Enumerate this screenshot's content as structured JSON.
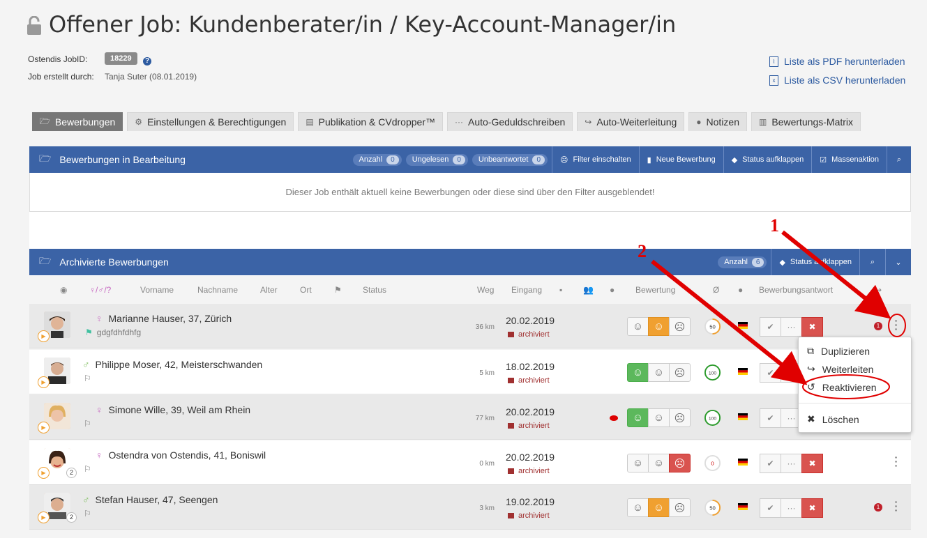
{
  "header": {
    "title": "Offener Job: Kundenberater/in / Key-Account-Manager/in",
    "jobid_label": "Ostendis JobID:",
    "jobid_value": "18229",
    "created_label": "Job erstellt durch:",
    "created_value": "Tanja Suter (08.01.2019)",
    "pdf_link": "Liste als PDF herunterladen",
    "csv_link": "Liste als CSV herunterladen"
  },
  "tabs": [
    {
      "label": "Bewerbungen",
      "icon": "folder-open-icon"
    },
    {
      "label": "Einstellungen & Berechtigungen",
      "icon": "gears-icon"
    },
    {
      "label": "Publikation & CVdropper™",
      "icon": "id-card-icon"
    },
    {
      "label": "Auto-Geduldschreiben",
      "icon": "ellipsis-icon"
    },
    {
      "label": "Auto-Weiterleitung",
      "icon": "share-icon"
    },
    {
      "label": "Notizen",
      "icon": "comment-icon"
    },
    {
      "label": "Bewertungs-Matrix",
      "icon": "bar-chart-icon"
    }
  ],
  "panel1": {
    "title": "Bewerbungen in Bearbeitung",
    "pills": [
      {
        "label": "Anzahl",
        "count": "0"
      },
      {
        "label": "Ungelesen",
        "count": "0"
      },
      {
        "label": "Unbeantwortet",
        "count": "0"
      }
    ],
    "buttons": [
      "Filter einschalten",
      "Neue Bewerbung",
      "Status aufklappen",
      "Massenaktion"
    ],
    "empty": "Dieser Job enthält aktuell keine Bewerbungen oder diese sind über den Filter ausgeblendet!"
  },
  "panel2": {
    "title": "Archivierte Bewerbungen",
    "pill_label": "Anzahl",
    "pill_count": "6",
    "status_btn": "Status aufklappen"
  },
  "columns": {
    "gender": "♀/♂/?",
    "vorname": "Vorname",
    "nachname": "Nachname",
    "alter": "Alter",
    "ort": "Ort",
    "status": "Status",
    "weg": "Weg",
    "eingang": "Eingang",
    "bewertung": "Bewertung",
    "avg": "Ø",
    "antwort": "Bewerbungsantwort"
  },
  "rows": [
    {
      "name": "Marianne Hauser, 37, Zürich",
      "gender": "female",
      "status": "gdgfdhfdhfg",
      "km": "36 km",
      "date": "20.02.2019",
      "state": "archiviert",
      "rating": "neutral",
      "score": "50",
      "notif": "1"
    },
    {
      "name": "Philippe Moser, 42, Meisterschwanden",
      "gender": "male",
      "status": "",
      "km": "5 km",
      "date": "18.02.2019",
      "state": "archiviert",
      "rating": "good",
      "score": "100",
      "notif": ""
    },
    {
      "name": "Simone Wille, 39, Weil am Rhein",
      "gender": "female",
      "status": "",
      "km": "77 km",
      "date": "20.02.2019",
      "state": "archiviert",
      "rating": "good",
      "score": "100",
      "notif": ""
    },
    {
      "name": "Ostendra von Ostendis, 41, Boniswil",
      "gender": "female",
      "status": "",
      "km": "0 km",
      "date": "20.02.2019",
      "state": "archiviert",
      "rating": "bad",
      "score": "0",
      "notif": "",
      "count": "2"
    },
    {
      "name": "Stefan Hauser, 47, Seengen",
      "gender": "male",
      "status": "",
      "km": "3 km",
      "date": "19.02.2019",
      "state": "archiviert",
      "rating": "neutral",
      "score": "50",
      "notif": "1",
      "count": "2"
    }
  ],
  "menu": {
    "duplicate": "Duplizieren",
    "forward": "Weiterleiten",
    "reactivate": "Reaktivieren",
    "delete": "Löschen"
  },
  "annotations": {
    "step1": "1",
    "step2": "2"
  },
  "colors": {
    "primary": "#3b63a6",
    "danger": "#d9534f",
    "success": "#5cb85c",
    "warning": "#f0a030",
    "annotation": "#e00000"
  }
}
